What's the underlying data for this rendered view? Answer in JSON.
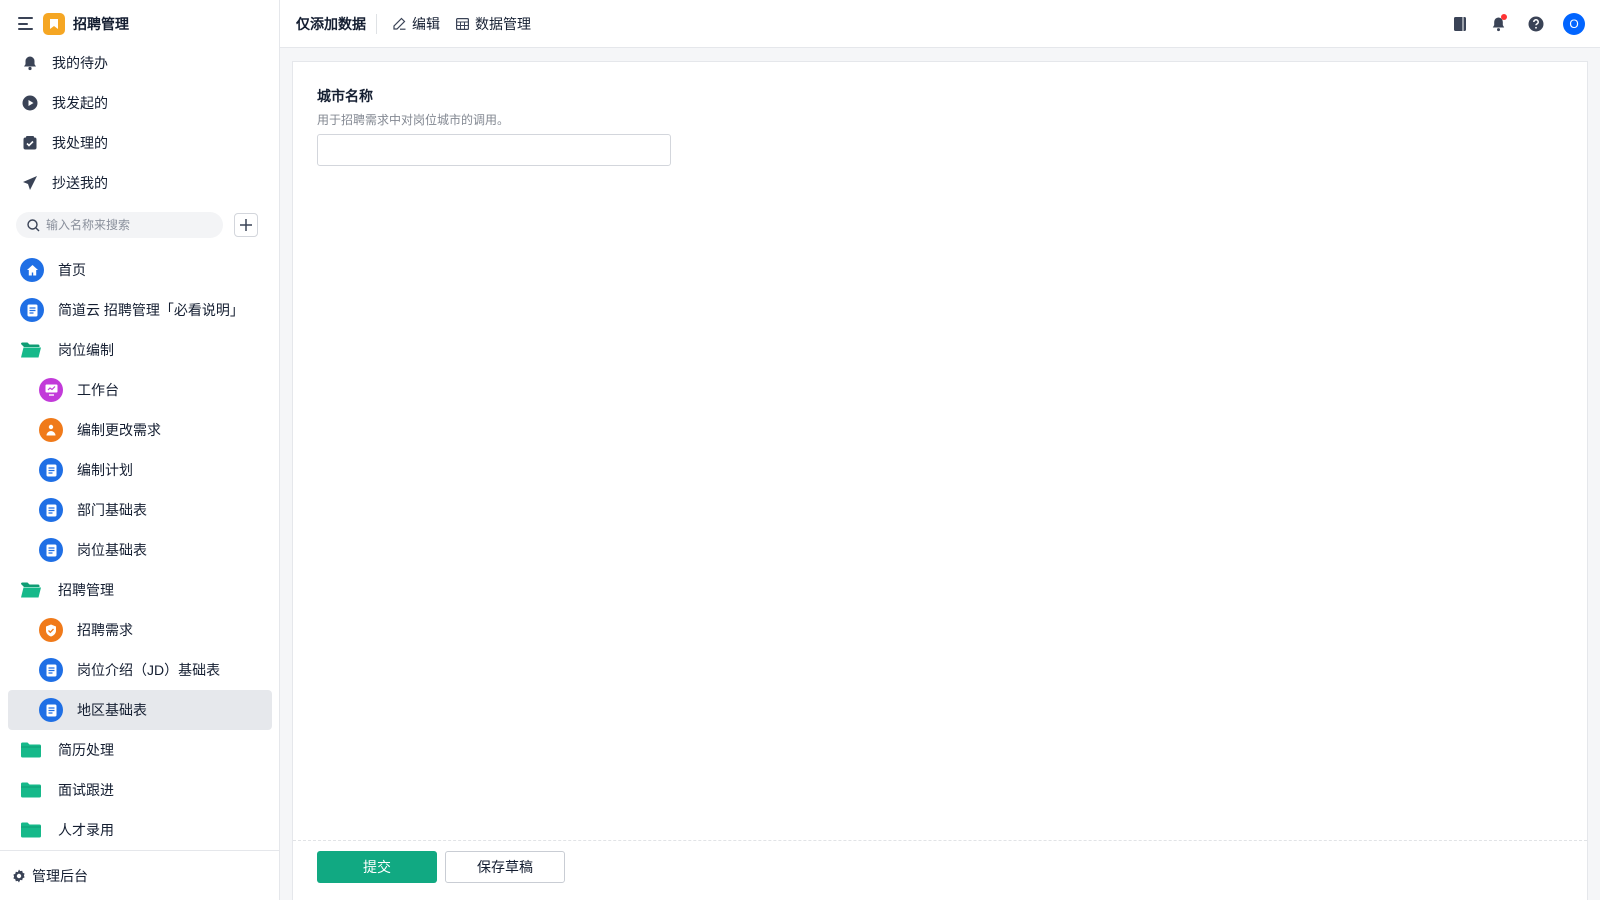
{
  "app": {
    "title": "招聘管理",
    "accent": "#11a982",
    "logo_color": "#f5a623"
  },
  "quick": [
    {
      "label": "我的待办",
      "icon": "bell-icon"
    },
    {
      "label": "我发起的",
      "icon": "play-circle-icon"
    },
    {
      "label": "我处理的",
      "icon": "check-box-icon"
    },
    {
      "label": "抄送我的",
      "icon": "send-icon"
    }
  ],
  "search": {
    "placeholder": "输入名称来搜索"
  },
  "nav": [
    {
      "label": "首页",
      "icon": "home-icon",
      "color": "#1f6fe5"
    },
    {
      "label": "简道云 招聘管理「必看说明」",
      "icon": "form-icon",
      "color": "#1f6fe5"
    },
    {
      "label": "岗位编制",
      "icon": "folder-icon"
    },
    {
      "label": "工作台",
      "icon": "dashboard-icon",
      "color": "#c23ad9"
    },
    {
      "label": "编制更改需求",
      "icon": "flow-icon",
      "color": "#f07a1a"
    },
    {
      "label": "编制计划",
      "icon": "form-icon",
      "color": "#1f6fe5"
    },
    {
      "label": "部门基础表",
      "icon": "form-icon",
      "color": "#1f6fe5"
    },
    {
      "label": "岗位基础表",
      "icon": "form-icon",
      "color": "#1f6fe5"
    },
    {
      "label": "招聘管理",
      "icon": "folder-icon"
    },
    {
      "label": "招聘需求",
      "icon": "shield-icon",
      "color": "#f07a1a"
    },
    {
      "label": "岗位介绍（JD）基础表",
      "icon": "form-icon",
      "color": "#1f6fe5"
    },
    {
      "label": "地区基础表",
      "icon": "form-icon",
      "color": "#1f6fe5"
    },
    {
      "label": "简历处理",
      "icon": "folder-icon"
    },
    {
      "label": "面试跟进",
      "icon": "folder-icon"
    },
    {
      "label": "人才录用",
      "icon": "folder-icon"
    }
  ],
  "footer": {
    "label": "管理后台"
  },
  "topbar": {
    "title": "仅添加数据",
    "edit_label": "编辑",
    "data_label": "数据管理",
    "avatar": "O"
  },
  "form": {
    "field_title": "城市名称",
    "field_desc": "用于招聘需求中对岗位城市的调用。",
    "field_value": "",
    "submit_label": "提交",
    "draft_label": "保存草稿"
  }
}
